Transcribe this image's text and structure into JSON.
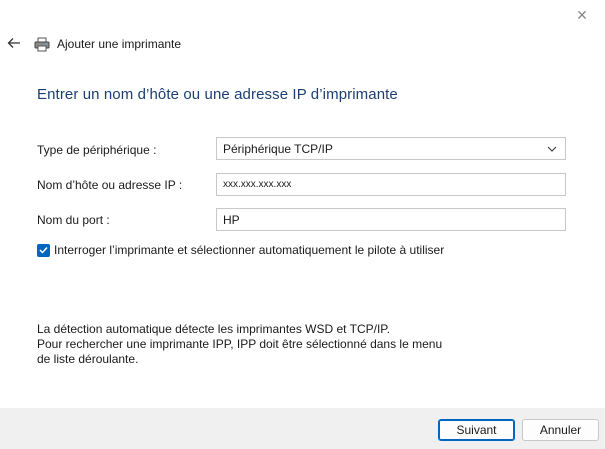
{
  "window": {
    "title": "Ajouter une imprimante",
    "close_glyph": "✕",
    "back_glyph": "←"
  },
  "main": {
    "heading": "Entrer un nom d’hôte ou une adresse IP d’imprimante",
    "device_type": {
      "label": "Type de périphérique :",
      "value": "Périphérique TCP/IP"
    },
    "hostname": {
      "label": "Nom d’hôte ou adresse IP :",
      "value": "xxx.xxx.xxx.xxx"
    },
    "port": {
      "label": "Nom du port :",
      "value": "HP"
    },
    "auto_driver": {
      "label": "Interroger l’imprimante et sélectionner automatiquement le pilote à utiliser",
      "checked": true
    },
    "info_lines": [
      "La détection automatique détecte les imprimantes WSD et TCP/IP.",
      "Pour rechercher une imprimante IPP, IPP doit être sélectionné dans le menu",
      "de liste déroulante."
    ]
  },
  "footer": {
    "next_label": "Suivant",
    "cancel_label": "Annuler"
  },
  "colors": {
    "accent": "#0067c0",
    "heading": "#1c3f73",
    "footer_bg": "#f0f0f0"
  },
  "icons": [
    "close-icon",
    "back-arrow-icon",
    "printer-icon",
    "chevron-down-icon",
    "checkmark-icon"
  ]
}
